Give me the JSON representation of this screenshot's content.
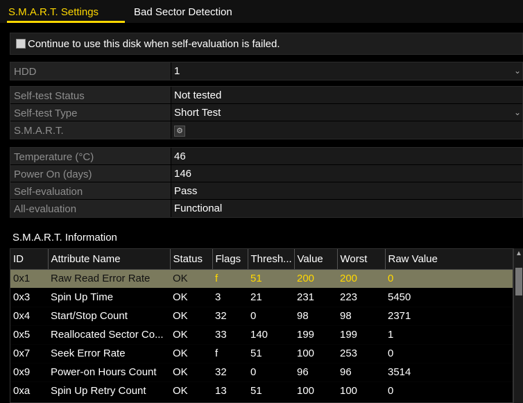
{
  "tabs": [
    {
      "label": "S.M.A.R.T. Settings",
      "active": true
    },
    {
      "label": "Bad Sector Detection",
      "active": false
    }
  ],
  "continue_checkbox": {
    "label": "Continue to use this disk when self-evaluation is failed.",
    "checked": false
  },
  "fields_top": [
    {
      "label": "HDD",
      "value": "1"
    }
  ],
  "fields_test": [
    {
      "label": "Self-test Status",
      "value": "Not tested"
    },
    {
      "label": "Self-test Type",
      "value": "Short Test"
    },
    {
      "label": "S.M.A.R.T.",
      "value": "⚙"
    }
  ],
  "fields_status": [
    {
      "label": "Temperature (°C)",
      "value": "46"
    },
    {
      "label": "Power On (days)",
      "value": "146"
    },
    {
      "label": "Self-evaluation",
      "value": "Pass"
    },
    {
      "label": "All-evaluation",
      "value": "Functional"
    }
  ],
  "info_title": "S.M.A.R.T. Information",
  "table": {
    "headers": [
      "ID",
      "Attribute Name",
      "Status",
      "Flags",
      "Thresh...",
      "Value",
      "Worst",
      "Raw Value"
    ],
    "rows": [
      [
        "0x1",
        "Raw Read Error Rate",
        "OK",
        "f",
        "51",
        "200",
        "200",
        "0"
      ],
      [
        "0x3",
        "Spin Up Time",
        "OK",
        "3",
        "21",
        "231",
        "223",
        "5450"
      ],
      [
        "0x4",
        "Start/Stop Count",
        "OK",
        "32",
        "0",
        "98",
        "98",
        "2371"
      ],
      [
        "0x5",
        "Reallocated Sector Co...",
        "OK",
        "33",
        "140",
        "199",
        "199",
        "1"
      ],
      [
        "0x7",
        "Seek Error Rate",
        "OK",
        "f",
        "51",
        "100",
        "253",
        "0"
      ],
      [
        "0x9",
        "Power-on Hours Count",
        "OK",
        "32",
        "0",
        "96",
        "96",
        "3514"
      ],
      [
        "0xa",
        "Spin Up Retry Count",
        "OK",
        "13",
        "51",
        "100",
        "100",
        "0"
      ]
    ],
    "selected_row": 0
  },
  "colors": {
    "accent": "#ffd800",
    "selected_row": "#7b7a5d",
    "label_text": "#8e8e8e"
  }
}
